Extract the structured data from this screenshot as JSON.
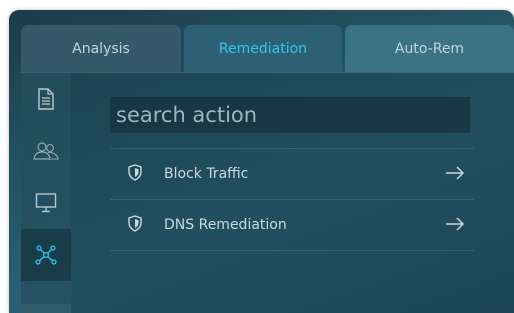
{
  "tabs": [
    {
      "label": "Analysis"
    },
    {
      "label": "Remediation"
    },
    {
      "label": "Auto-Rem"
    }
  ],
  "active_tab": "Remediation",
  "sidebar": {
    "items": [
      {
        "icon": "document-icon",
        "active": false
      },
      {
        "icon": "users-icon",
        "active": false
      },
      {
        "icon": "monitor-icon",
        "active": false
      },
      {
        "icon": "network-icon",
        "active": true
      }
    ]
  },
  "search": {
    "placeholder": "search action",
    "value": ""
  },
  "actions": [
    {
      "label": "Block Traffic",
      "icon": "shield-icon",
      "arrow": "arrow-right-icon"
    },
    {
      "label": "DNS Remediation",
      "icon": "shield-icon",
      "arrow": "arrow-right-icon"
    }
  ],
  "colors": {
    "accent": "#35c5ef",
    "text": "#cad9de"
  }
}
